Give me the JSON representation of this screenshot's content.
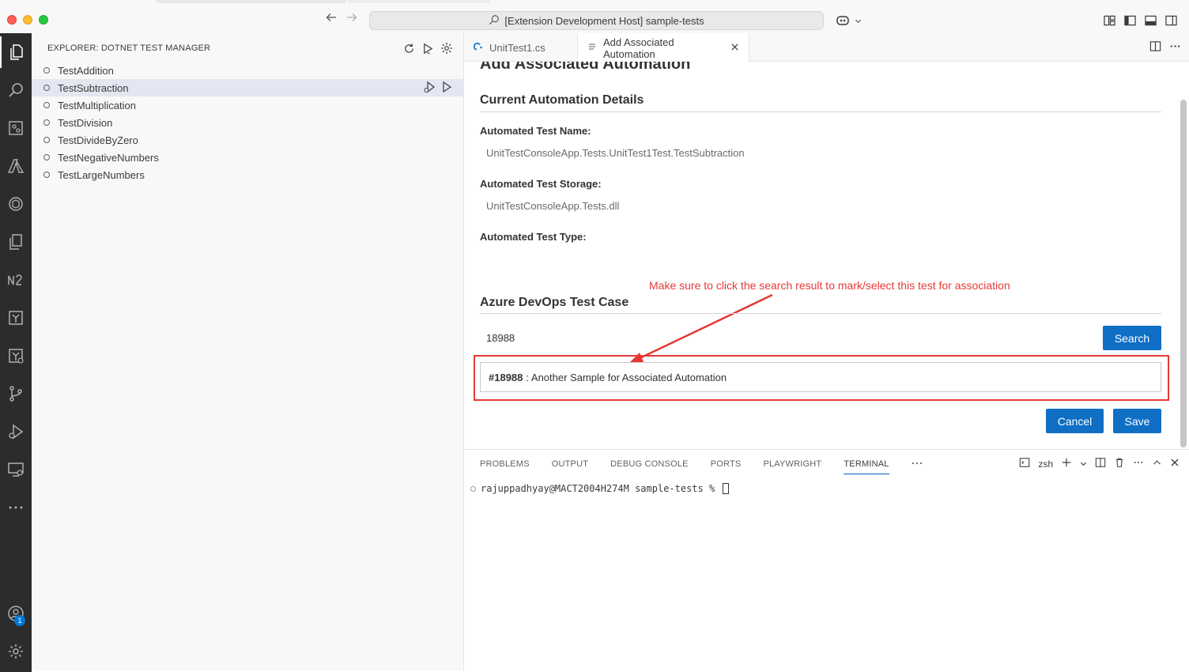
{
  "window": {
    "title": "[Extension Development Host] sample-tests"
  },
  "sidebar": {
    "title": "EXPLORER: DOTNET TEST MANAGER",
    "tests": [
      {
        "label": "TestAddition"
      },
      {
        "label": "TestSubtraction"
      },
      {
        "label": "TestMultiplication"
      },
      {
        "label": "TestDivision"
      },
      {
        "label": "TestDivideByZero"
      },
      {
        "label": "TestNegativeNumbers"
      },
      {
        "label": "TestLargeNumbers"
      }
    ]
  },
  "editor": {
    "tabs": [
      {
        "label": "UnitTest1.cs"
      },
      {
        "label": "Add Associated Automation"
      }
    ]
  },
  "webview": {
    "heading": "Add Associated Automation",
    "current_section_title": "Current Automation Details",
    "test_name_label": "Automated Test Name:",
    "test_name_value": "UnitTestConsoleApp.Tests.UnitTest1Test.TestSubtraction",
    "test_storage_label": "Automated Test Storage:",
    "test_storage_value": "UnitTestConsoleApp.Tests.dll",
    "test_type_label": "Automated Test Type:",
    "annotation": "Make sure to click the search result to mark/select this test for association",
    "azure_section_title": "Azure DevOps Test Case",
    "search_value": "18988",
    "search_button": "Search",
    "result_id": "#18988",
    "result_text": ": Another Sample for Associated Automation",
    "cancel_button": "Cancel",
    "save_button": "Save"
  },
  "panel": {
    "tabs": [
      {
        "label": "PROBLEMS"
      },
      {
        "label": "OUTPUT"
      },
      {
        "label": "DEBUG CONSOLE"
      },
      {
        "label": "PORTS"
      },
      {
        "label": "PLAYWRIGHT"
      },
      {
        "label": "TERMINAL"
      }
    ],
    "shell_label": "zsh",
    "terminal_prompt": "rajuppadhyay@MACT2004H274M sample-tests %"
  },
  "accounts_badge": "1",
  "colors": {
    "accent": "#0e6fc5",
    "annotation": "#e53935",
    "activity_bar": "#2c2c2c"
  }
}
